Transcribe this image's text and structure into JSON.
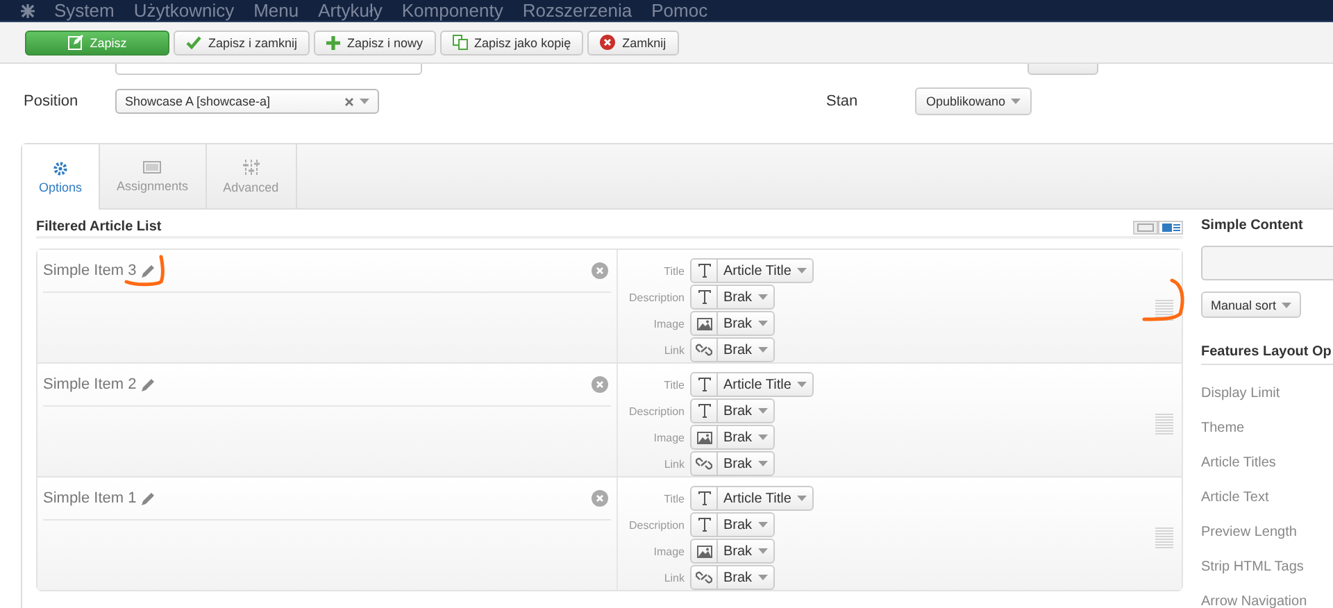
{
  "nav": {
    "items": [
      "System",
      "Użytkownicy",
      "Menu",
      "Artykuły",
      "Komponenty",
      "Rozszerzenia",
      "Pomoc"
    ]
  },
  "toolbar": [
    {
      "label": "Zapisz",
      "kind": "save"
    },
    {
      "label": "Zapisz i zamknij",
      "kind": "save_close"
    },
    {
      "label": "Zapisz i nowy",
      "kind": "save_new"
    },
    {
      "label": "Zapisz jako kopię",
      "kind": "save_copy"
    },
    {
      "label": "Zamknij",
      "kind": "close"
    }
  ],
  "form": {
    "position_label": "Position",
    "position_value": "Showcase A [showcase-a]",
    "status_label": "Stan",
    "status_value": "Opublikowano"
  },
  "tabs": [
    {
      "label": "Options",
      "kind": "options",
      "selected": true
    },
    {
      "label": "Assignments",
      "kind": "assignments",
      "selected": false
    },
    {
      "label": "Advanced",
      "kind": "advanced",
      "selected": false
    }
  ],
  "article_list": {
    "heading": "Filtered Article List",
    "view_toggle": [
      {
        "selected": false
      },
      {
        "selected": true
      }
    ],
    "items": [
      {
        "title": "Simple Item 3",
        "fields": [
          {
            "label": "Title",
            "kind": "text",
            "value": "Article Title"
          },
          {
            "label": "Description",
            "kind": "text",
            "value": "Brak"
          },
          {
            "label": "Image",
            "kind": "image",
            "value": "Brak"
          },
          {
            "label": "Link",
            "kind": "link",
            "value": "Brak"
          }
        ]
      },
      {
        "title": "Simple Item 2",
        "fields": [
          {
            "label": "Title",
            "kind": "text",
            "value": "Article Title"
          },
          {
            "label": "Description",
            "kind": "text",
            "value": "Brak"
          },
          {
            "label": "Image",
            "kind": "image",
            "value": "Brak"
          },
          {
            "label": "Link",
            "kind": "link",
            "value": "Brak"
          }
        ]
      },
      {
        "title": "Simple Item 1",
        "fields": [
          {
            "label": "Title",
            "kind": "text",
            "value": "Article Title"
          },
          {
            "label": "Description",
            "kind": "text",
            "value": "Brak"
          },
          {
            "label": "Image",
            "kind": "image",
            "value": "Brak"
          },
          {
            "label": "Link",
            "kind": "link",
            "value": "Brak"
          }
        ]
      }
    ]
  },
  "simple_content": {
    "heading": "Simple Content",
    "sort_button": "Manual sort"
  },
  "features_layout": {
    "heading": "Features Layout Op",
    "labels": [
      "Display Limit",
      "Theme",
      "Article Titles",
      "Article Text",
      "Preview Length",
      "Strip HTML Tags",
      "Arrow Navigation"
    ]
  }
}
